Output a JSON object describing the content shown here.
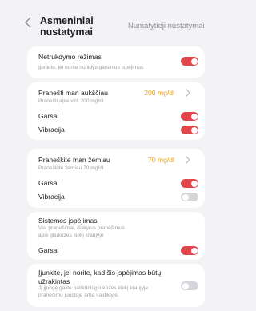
{
  "header": {
    "title": "Asmeniniai nustatymai",
    "reset_label": "Numatytieji nustatymai",
    "back_icon": "chevron-left-icon"
  },
  "card1": {
    "title": "Netrukdymo režimas",
    "subtitle": "Įjunkite, jei norite nutildyti garsinius įspėjimus",
    "toggle_on": true
  },
  "card2": {
    "title": "Pranešti man aukščiau",
    "subtitle": "Pranešti apie virš 200 mg/dl",
    "value": "200 mg/dl",
    "sounds_label": "Garsai",
    "sounds_on": true,
    "vibration_label": "Vibracija",
    "vibration_on": true
  },
  "card3": {
    "title": "Praneškite man žemiau",
    "subtitle": "Praneškite žemiau 70 mg/dl",
    "value": "70 mg/dl",
    "sounds_label": "Garsai",
    "sounds_on": true,
    "vibration_label": "Vibracija",
    "vibration_on": false
  },
  "card4": {
    "title": "Sistemos įspėjimas",
    "subtitle": "Visi pranešimai, išskyrus pranešimus apie gliukozės kiekį kraujyje",
    "sounds_label": "Garsai",
    "sounds_on": true
  },
  "card5": {
    "title": "Įjunkite, jei norite, kad šis įspėjimas būtų užrakintas",
    "subtitle": "Jį įjungę galite patikrinti gliukozės kiekį kraujyje pranešimų juostoje arba valdiklyje,",
    "toggle_on": false
  },
  "colors": {
    "accent": "#e0474c",
    "value": "#e8a11d",
    "toggle_off": "#d6d6da"
  }
}
